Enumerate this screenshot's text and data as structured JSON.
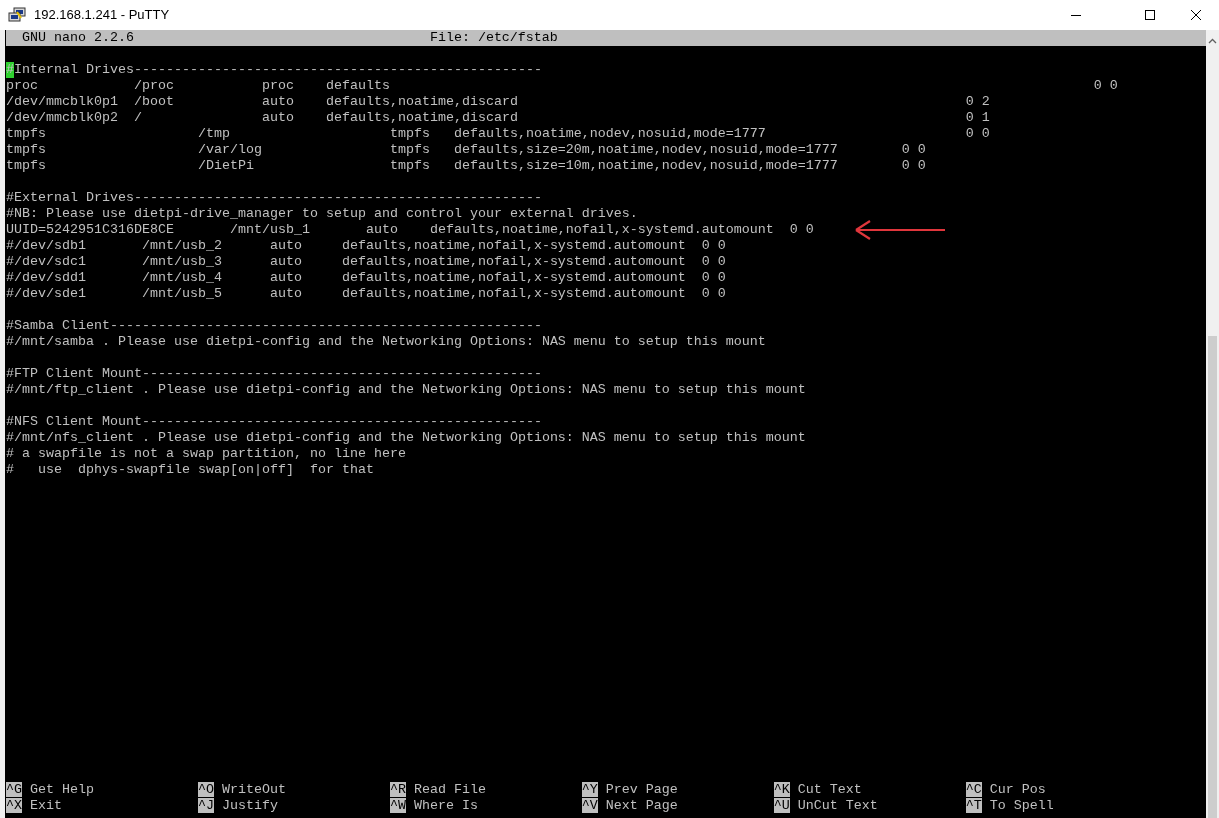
{
  "window": {
    "title": "192.168.1.241 - PuTTY"
  },
  "nano_header": {
    "version": "GNU nano 2.2.6",
    "file": "File: /etc/fstab"
  },
  "sections": [
    {
      "lines": [
        {
          "text": "#Internal Drives---------------------------------------------------",
          "cursor": true,
          "annotated": false
        },
        {
          "text": "proc            /proc           proc    defaults                                                                                        0 0",
          "cursor": false,
          "annotated": false
        },
        {
          "text": "/dev/mmcblk0p1  /boot           auto    defaults,noatime,discard                                                        0 2",
          "cursor": false,
          "annotated": false
        },
        {
          "text": "/dev/mmcblk0p2  /               auto    defaults,noatime,discard                                                        0 1",
          "cursor": false,
          "annotated": false
        },
        {
          "text": "tmpfs                   /tmp                    tmpfs   defaults,noatime,nodev,nosuid,mode=1777                         0 0",
          "cursor": false,
          "annotated": false
        },
        {
          "text": "tmpfs                   /var/log                tmpfs   defaults,size=20m,noatime,nodev,nosuid,mode=1777        0 0",
          "cursor": false,
          "annotated": false
        },
        {
          "text": "tmpfs                   /DietPi                 tmpfs   defaults,size=10m,noatime,nodev,nosuid,mode=1777        0 0",
          "cursor": false,
          "annotated": false
        }
      ]
    },
    {
      "lines": [
        {
          "text": "#External Drives---------------------------------------------------",
          "cursor": false,
          "annotated": false
        },
        {
          "text": "#NB: Please use dietpi-drive_manager to setup and control your external drives.",
          "cursor": false,
          "annotated": false
        },
        {
          "text": "UUID=5242951C316DE8CE       /mnt/usb_1       auto    defaults,noatime,nofail,x-systemd.automount  0 0",
          "cursor": false,
          "annotated": true
        },
        {
          "text": "#/dev/sdb1       /mnt/usb_2      auto     defaults,noatime,nofail,x-systemd.automount  0 0",
          "cursor": false,
          "annotated": false
        },
        {
          "text": "#/dev/sdc1       /mnt/usb_3      auto     defaults,noatime,nofail,x-systemd.automount  0 0",
          "cursor": false,
          "annotated": false
        },
        {
          "text": "#/dev/sdd1       /mnt/usb_4      auto     defaults,noatime,nofail,x-systemd.automount  0 0",
          "cursor": false,
          "annotated": false
        },
        {
          "text": "#/dev/sde1       /mnt/usb_5      auto     defaults,noatime,nofail,x-systemd.automount  0 0",
          "cursor": false,
          "annotated": false
        }
      ]
    },
    {
      "lines": [
        {
          "text": "#Samba Client------------------------------------------------------",
          "cursor": false,
          "annotated": false
        },
        {
          "text": "#/mnt/samba . Please use dietpi-config and the Networking Options: NAS menu to setup this mount",
          "cursor": false,
          "annotated": false
        }
      ]
    },
    {
      "lines": [
        {
          "text": "#FTP Client Mount--------------------------------------------------",
          "cursor": false,
          "annotated": false
        },
        {
          "text": "#/mnt/ftp_client . Please use dietpi-config and the Networking Options: NAS menu to setup this mount",
          "cursor": false,
          "annotated": false
        }
      ]
    },
    {
      "lines": [
        {
          "text": "#NFS Client Mount--------------------------------------------------",
          "cursor": false,
          "annotated": false
        },
        {
          "text": "#/mnt/nfs_client . Please use dietpi-config and the Networking Options: NAS menu to setup this mount",
          "cursor": false,
          "annotated": false
        },
        {
          "text": "# a swapfile is not a swap partition, no line here",
          "cursor": false,
          "annotated": false
        },
        {
          "text": "#   use  dphys-swapfile swap[on|off]  for that",
          "cursor": false,
          "annotated": false
        }
      ]
    }
  ],
  "shortcut_rows": [
    [
      {
        "key": "^G",
        "label": "Get Help"
      },
      {
        "key": "^O",
        "label": "WriteOut"
      },
      {
        "key": "^R",
        "label": "Read File"
      },
      {
        "key": "^Y",
        "label": "Prev Page"
      },
      {
        "key": "^K",
        "label": "Cut Text"
      },
      {
        "key": "^C",
        "label": "Cur Pos"
      }
    ],
    [
      {
        "key": "^X",
        "label": "Exit"
      },
      {
        "key": "^J",
        "label": "Justify"
      },
      {
        "key": "^W",
        "label": "Where Is"
      },
      {
        "key": "^V",
        "label": "Next Page"
      },
      {
        "key": "^U",
        "label": "UnCut Text"
      },
      {
        "key": "^T",
        "label": "To Spell"
      }
    ]
  ]
}
